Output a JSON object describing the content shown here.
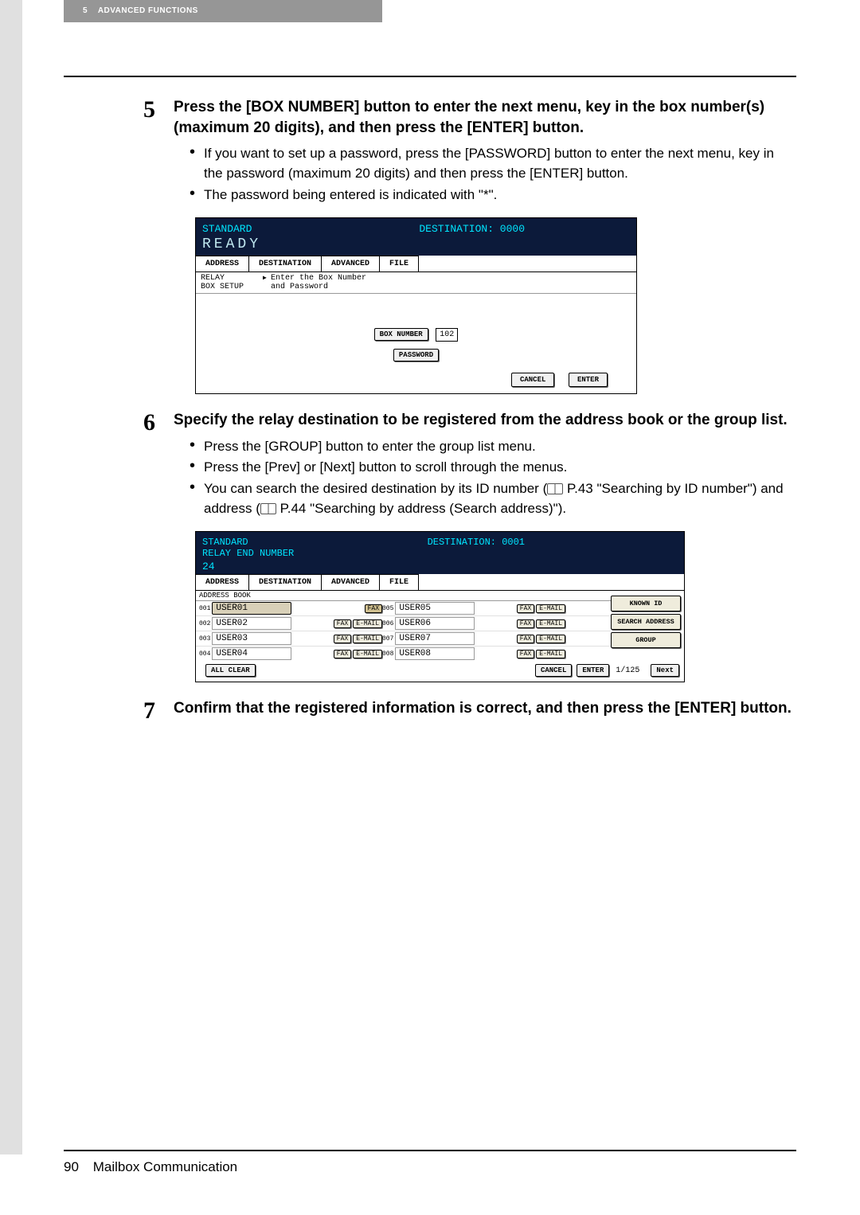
{
  "header": {
    "pagenum": "5",
    "title": "ADVANCED FUNCTIONS"
  },
  "step5": {
    "num": "5",
    "title": "Press the [BOX NUMBER] button to enter the next menu, key in the box number(s) (maximum 20 digits), and then press the [ENTER] button.",
    "b1": "If you want to set up a password, press the [PASSWORD] button to enter the next menu, key in the password (maximum 20 digits) and then press the [ENTER] button.",
    "b2": "The password being entered is indicated with \"*\"."
  },
  "ss1": {
    "standard": "STANDARD",
    "dest": "DESTINATION: 0000",
    "ready": "READY",
    "tabs": {
      "address": "ADDRESS",
      "destination": "DESTINATION",
      "advanced": "ADVANCED",
      "file": "FILE"
    },
    "sub": {
      "label": "RELAY\nBOX SETUP",
      "hint1": "Enter the Box Number",
      "hint2": "and Password"
    },
    "boxnum_btn": "BOX NUMBER",
    "boxnum_val": "102",
    "password_btn": "PASSWORD",
    "cancel": "CANCEL",
    "enter": "ENTER"
  },
  "step6": {
    "num": "6",
    "title": "Specify the relay destination to be registered from the address book or the group list.",
    "b1": "Press the [GROUP] button to enter the group list menu.",
    "b2": "Press the [Prev] or [Next] button to scroll through the menus.",
    "b3a": "You can search the desired destination by its ID number (",
    "b3b": " P.43 \"Searching by ID number\") and address (",
    "b3c": " P.44 \"Searching by address (Search address)\")."
  },
  "ss2": {
    "standard": "STANDARD",
    "dest": "DESTINATION: 0001",
    "relay": "RELAY END NUMBER",
    "count": "24",
    "tabs": {
      "address": "ADDRESS",
      "destination": "DESTINATION",
      "advanced": "ADVANCED",
      "file": "FILE"
    },
    "ablabel": "ADDRESS BOOK",
    "rows": [
      {
        "idx1": "001",
        "name1": "USER01",
        "fax1": "FAX",
        "mail1": "",
        "sel": true,
        "idx2": "005",
        "name2": "USER05",
        "fax2": "FAX",
        "mail2": "E-MAIL"
      },
      {
        "idx1": "002",
        "name1": "USER02",
        "fax1": "FAX",
        "mail1": "E-MAIL",
        "sel": false,
        "idx2": "006",
        "name2": "USER06",
        "fax2": "FAX",
        "mail2": "E-MAIL"
      },
      {
        "idx1": "003",
        "name1": "USER03",
        "fax1": "FAX",
        "mail1": "E-MAIL",
        "sel": false,
        "idx2": "007",
        "name2": "USER07",
        "fax2": "FAX",
        "mail2": "E-MAIL"
      },
      {
        "idx1": "004",
        "name1": "USER04",
        "fax1": "FAX",
        "mail1": "E-MAIL",
        "sel": false,
        "idx2": "008",
        "name2": "USER08",
        "fax2": "FAX",
        "mail2": "E-MAIL"
      }
    ],
    "side": {
      "known": "KNOWN ID",
      "search": "SEARCH ADDRESS",
      "group": "GROUP"
    },
    "foot": {
      "allclear": "ALL CLEAR",
      "cancel": "CANCEL",
      "enter": "ENTER",
      "pag": "1/125",
      "next": "Next"
    }
  },
  "step7": {
    "num": "7",
    "title": "Confirm that the registered information is correct, and then press the [ENTER] button."
  },
  "footer": {
    "pagenum": "90",
    "title": "Mailbox Communication"
  }
}
